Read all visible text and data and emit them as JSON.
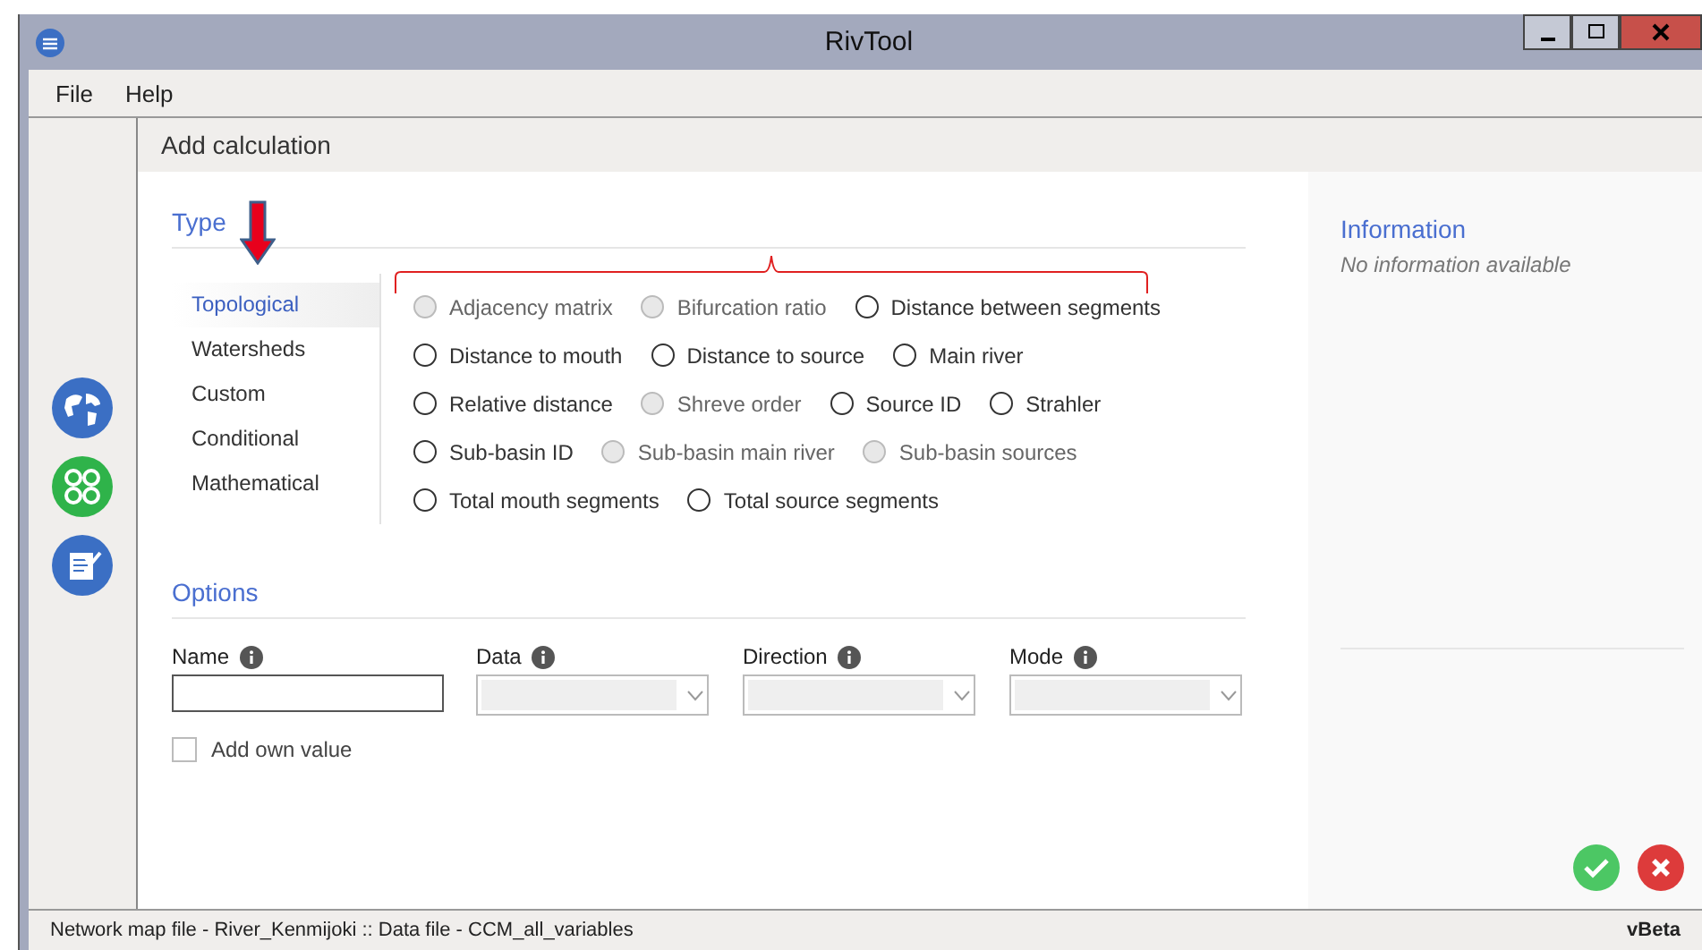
{
  "window": {
    "title": "RivTool"
  },
  "menu": [
    "File",
    "Help"
  ],
  "header": "Add calculation",
  "type_section": {
    "title": "Type",
    "categories": [
      {
        "label": "Topological",
        "selected": true
      },
      {
        "label": "Watersheds",
        "selected": false
      },
      {
        "label": "Custom",
        "selected": false
      },
      {
        "label": "Conditional",
        "selected": false
      },
      {
        "label": "Mathematical",
        "selected": false
      }
    ],
    "option_rows": [
      [
        {
          "label": "Adjacency matrix",
          "disabled": true
        },
        {
          "label": "Bifurcation ratio",
          "disabled": true
        },
        {
          "label": "Distance between segments",
          "disabled": false
        }
      ],
      [
        {
          "label": "Distance to mouth",
          "disabled": false
        },
        {
          "label": "Distance to source",
          "disabled": false
        },
        {
          "label": "Main river",
          "disabled": false
        }
      ],
      [
        {
          "label": "Relative distance",
          "disabled": false
        },
        {
          "label": "Shreve order",
          "disabled": true
        },
        {
          "label": "Source ID",
          "disabled": false
        },
        {
          "label": "Strahler",
          "disabled": false
        }
      ],
      [
        {
          "label": "Sub-basin ID",
          "disabled": false
        },
        {
          "label": "Sub-basin main river",
          "disabled": true
        },
        {
          "label": "Sub-basin sources",
          "disabled": true
        }
      ],
      [
        {
          "label": "Total mouth segments",
          "disabled": false
        },
        {
          "label": "Total source segments",
          "disabled": false
        }
      ]
    ]
  },
  "options_section": {
    "title": "Options",
    "fields": [
      {
        "label": "Name",
        "kind": "text",
        "disabled": false
      },
      {
        "label": "Data",
        "kind": "dropdown",
        "disabled": true
      },
      {
        "label": "Direction",
        "kind": "dropdown",
        "disabled": true
      },
      {
        "label": "Mode",
        "kind": "dropdown",
        "disabled": true
      }
    ],
    "checkbox": {
      "label": "Add own value",
      "checked": false
    }
  },
  "information": {
    "title": "Information",
    "text": "No information available"
  },
  "status_bar": {
    "text": "Network map file - River_Kenmijoki  ::  Data file - CCM_all_variables",
    "version": "vBeta"
  }
}
